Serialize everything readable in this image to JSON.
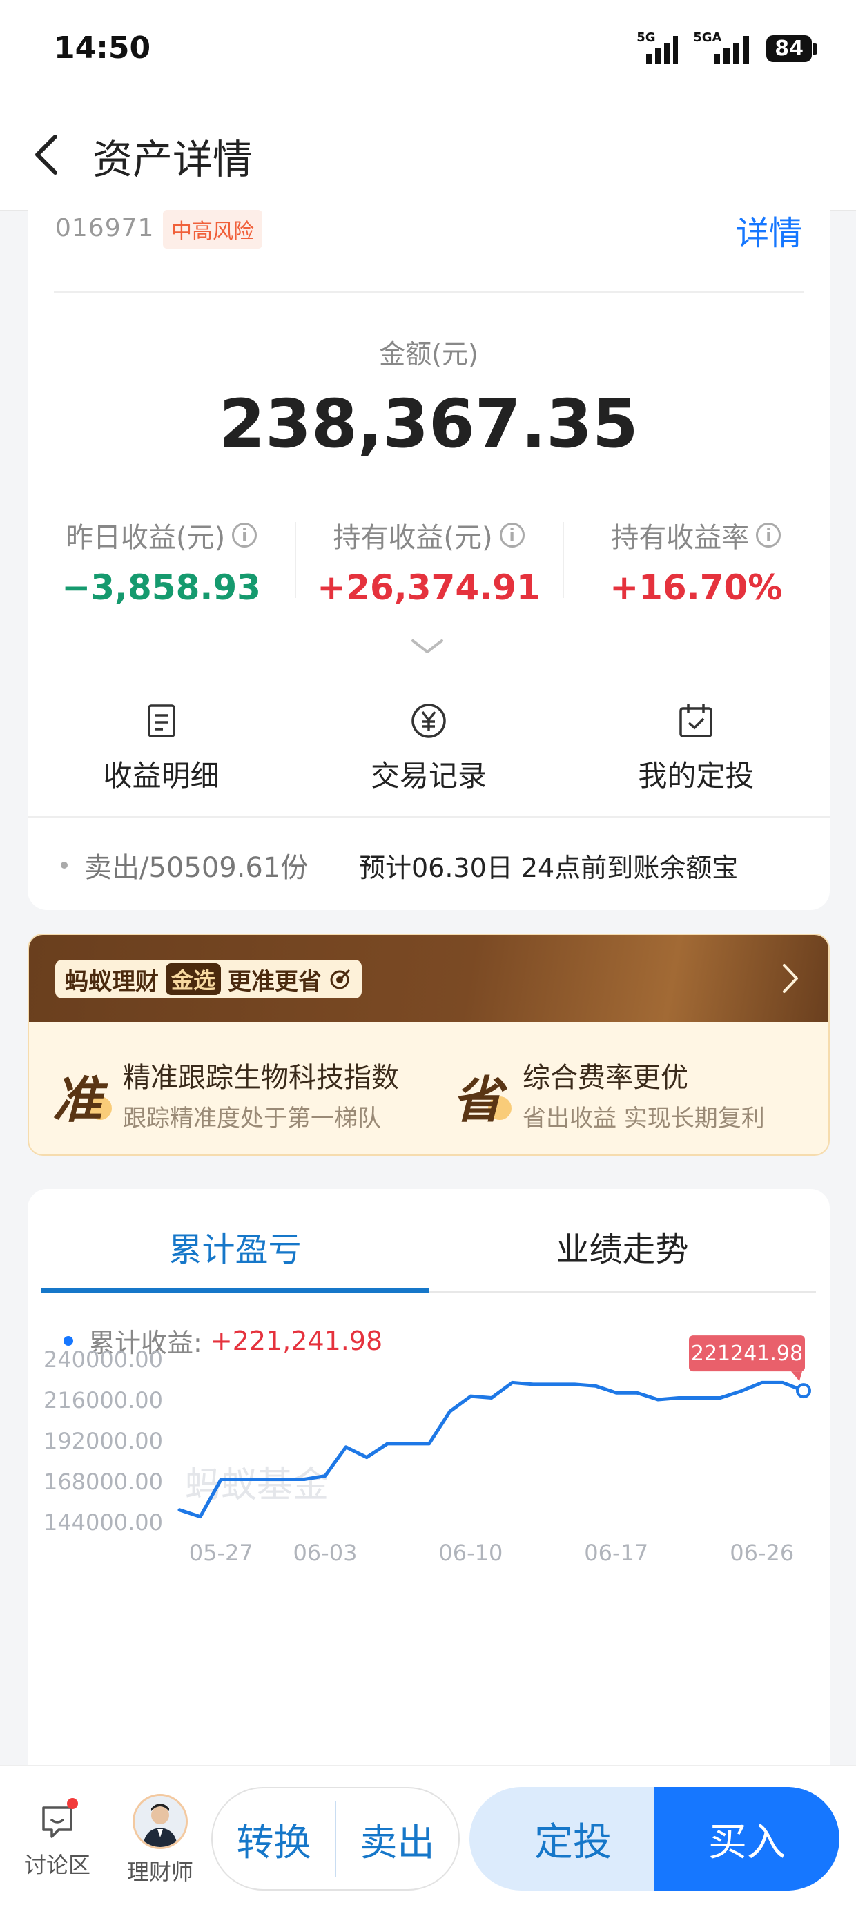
{
  "status_bar": {
    "time": "14:50",
    "signal1_label": "5G",
    "signal2_label": "5GA",
    "battery": "84"
  },
  "nav": {
    "back_icon": "chevron-left-icon",
    "title": "资产详情"
  },
  "fund": {
    "code": "016971",
    "risk": "中高风险",
    "detail_link": "详情",
    "amount_label": "金额(元)",
    "amount_value": "238,367.35",
    "metrics": [
      {
        "label": "昨日收益(元)",
        "value": "−3,858.93",
        "tone": "green"
      },
      {
        "label": "持有收益(元)",
        "value": "+26,374.91",
        "tone": "red"
      },
      {
        "label": "持有收益率",
        "value": "+16.70%",
        "tone": "red"
      }
    ],
    "actions": [
      {
        "label": "收益明细",
        "icon": "document-icon"
      },
      {
        "label": "交易记录",
        "icon": "yuan-circle-icon"
      },
      {
        "label": "我的定投",
        "icon": "calendar-check-icon"
      }
    ],
    "sell_info": "卖出/50509.61份",
    "sell_eta": "预计06.30日 24点前到账余额宝"
  },
  "promo": {
    "badge_brand": "蚂蚁理财",
    "badge_tag": "金选",
    "badge_slogan": "更准更省",
    "items": [
      {
        "glyph": "准",
        "title": "精准跟踪生物科技指数",
        "subtitle": "跟踪精准度处于第一梯队"
      },
      {
        "glyph": "省",
        "title": "综合费率更优",
        "subtitle": "省出收益 实现长期复利"
      }
    ]
  },
  "chart_tabs": {
    "active": "累计盈亏",
    "other": "业绩走势"
  },
  "legend": {
    "label": "累计收益:",
    "value": "+221,241.98"
  },
  "colors": {
    "accent_blue": "#1677ff",
    "loss_green": "#159a6e",
    "gain_red": "#e5323d",
    "tooltip": "#e9606b"
  },
  "chart_data": {
    "type": "line",
    "watermark": "蚂蚁基金",
    "tooltip_value": "221241.98",
    "y_ticks": [
      "240000.00",
      "216000.00",
      "192000.00",
      "168000.00",
      "144000.00"
    ],
    "ylim": [
      144000,
      240000
    ],
    "x_ticks": [
      "05-27",
      "06-03",
      "06-10",
      "06-17",
      "06-26"
    ],
    "x_tick_index": [
      2,
      7,
      14,
      21,
      28
    ],
    "series": [
      {
        "values": [
          151000,
          147000,
          169000,
          169000,
          169000,
          169000,
          169000,
          171000,
          188000,
          182000,
          190000,
          190000,
          190000,
          209000,
          218000,
          217000,
          226000,
          225000,
          225000,
          225000,
          224000,
          220000,
          220000,
          216000,
          217000,
          217000,
          217000,
          221000,
          226000,
          226000,
          221242
        ]
      }
    ]
  },
  "bottom_bar": {
    "discuss_label": "讨论区",
    "advisor_label": "理财师",
    "convert": "转换",
    "sell": "卖出",
    "dingtou": "定投",
    "buy": "买入"
  }
}
